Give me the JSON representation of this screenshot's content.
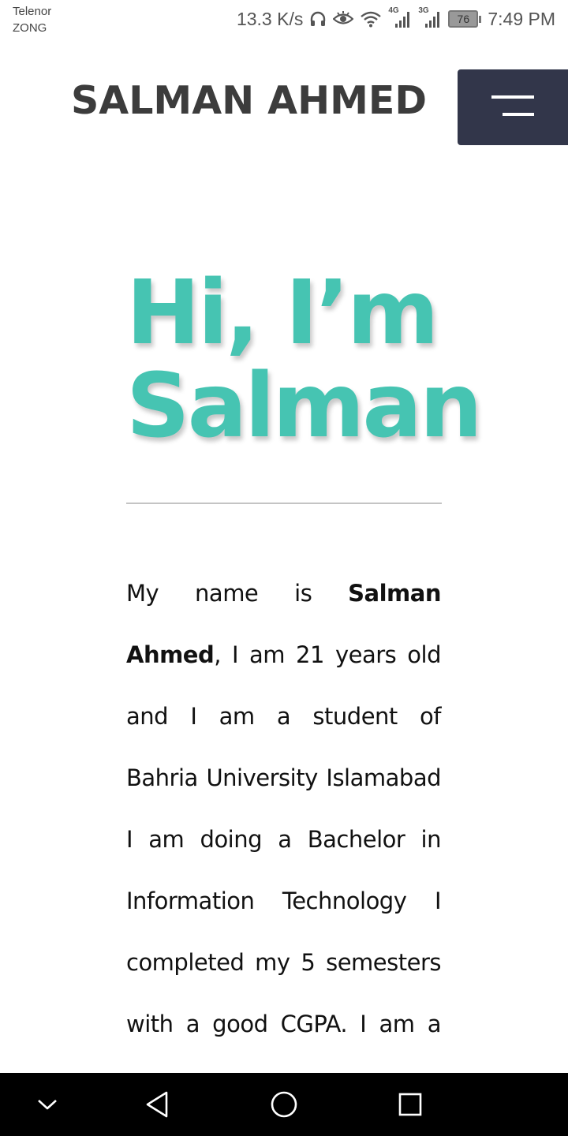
{
  "status_bar": {
    "carrier_1": "Telenor",
    "carrier_2": "ZONG",
    "speed": "13.3 K/s",
    "net_1": "4G",
    "net_2": "3G",
    "battery": "76",
    "time": "7:49 PM"
  },
  "header": {
    "title": "SALMAN AHMED",
    "menu_icon": "hamburger-menu-icon"
  },
  "hero": {
    "line1": "Hi, I’m",
    "line2": "Salman"
  },
  "intro": {
    "prefix": "My name is ",
    "name": "Salman Ahmed",
    "rest": ", I am 21 years old and I am a student of Bahria University Islamabad I am doing a Bachelor in Information Technology I completed my 5 semesters with a good CGPA. I am a self-driven"
  },
  "nav_bar": {
    "icons": [
      "collapse-icon",
      "back-icon",
      "home-icon",
      "recents-icon"
    ]
  },
  "colors": {
    "accent": "#46c4b2",
    "menu_button": "#32364a",
    "title": "#3c3c3c"
  }
}
